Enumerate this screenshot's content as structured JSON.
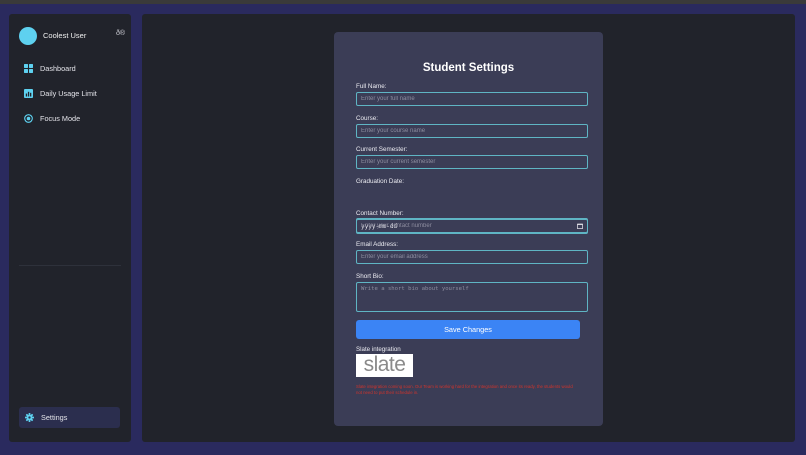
{
  "colors": {
    "background": "#2a2a5e",
    "panel": "#21232b",
    "card": "#3b3d56",
    "accent_cyan": "#5ed1f0",
    "input_border": "#5fb5c4",
    "primary_button": "#3b84f5",
    "warning_text": "#d0342c"
  },
  "sidebar": {
    "user": {
      "name": "Coolest User",
      "glyph": "ð®"
    },
    "items": [
      {
        "label": "Dashboard",
        "icon": "grid-icon"
      },
      {
        "label": "Daily Usage Limit",
        "icon": "chart-icon"
      },
      {
        "label": "Focus Mode",
        "icon": "focus-icon"
      }
    ],
    "settings": {
      "label": "Settings",
      "icon": "gear-icon",
      "active": true
    }
  },
  "form": {
    "title": "Student Settings",
    "fields": {
      "full_name": {
        "label": "Full Name:",
        "placeholder": "Enter your full name"
      },
      "course": {
        "label": "Course:",
        "placeholder": "Enter your course name"
      },
      "semester": {
        "label": "Current Semester:",
        "placeholder": "Enter your current semester"
      },
      "graduation": {
        "label": "Graduation Date:",
        "value": "yyyy-mm-dd"
      },
      "contact": {
        "label": "Contact Number:",
        "placeholder": "Enter your contact number"
      },
      "email": {
        "label": "Email Address:",
        "placeholder": "Enter your email address"
      },
      "bio": {
        "label": "Short Bio:",
        "placeholder": "Write a short bio about yourself"
      }
    },
    "save_label": "Save Changes",
    "slate": {
      "label": "Slate integration",
      "logo_text": "slate",
      "note": "Slate integration coming soon. Our Team is working hard for the integration and once its ready, the students would not need to put their schedule in."
    }
  }
}
